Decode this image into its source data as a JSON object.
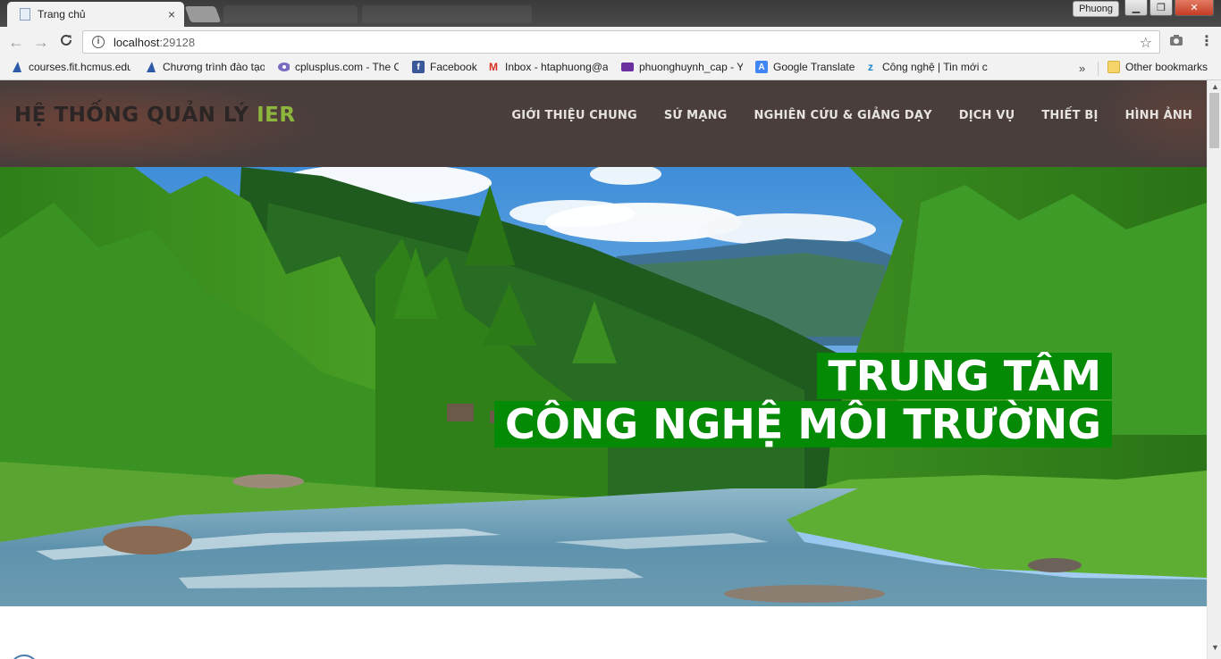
{
  "browser": {
    "tab_title": "Trang chủ",
    "tab_close": "×",
    "profile_name": "Phuong",
    "win_minimize": "▁",
    "win_maximize": "❐",
    "win_close": "✕",
    "url_host": "localhost",
    "url_port": ":29128",
    "back_icon": "←",
    "forward_icon": "→",
    "reload_icon": "C",
    "info_icon": "i",
    "star_icon": "☆",
    "camera_icon": "📷",
    "menu_icon": "⋮",
    "bookmarks": [
      {
        "label": "courses.fit.hcmus.edu",
        "icon": "wedge-icon",
        "color": "#2d5aa8"
      },
      {
        "label": "Chương trình đào tạo",
        "icon": "wedge-icon",
        "color": "#2d5aa8"
      },
      {
        "label": "cplusplus.com - The C",
        "icon": "puzzle-icon",
        "color": "#7a6ac0"
      },
      {
        "label": "Facebook",
        "icon": "facebook-icon",
        "color": "#3b5998"
      },
      {
        "label": "Inbox - htaphuong@a",
        "icon": "gmail-icon",
        "color": "#d93025"
      },
      {
        "label": "phuonghuynh_cap - Y",
        "icon": "mail-icon",
        "color": "#6b2fa0"
      },
      {
        "label": "Google Translate",
        "icon": "translate-icon",
        "color": "#4285f4"
      },
      {
        "label": "Công nghệ | Tin mới c",
        "icon": "zing-icon",
        "color": "#1e88c8"
      }
    ],
    "bookmarks_more": "»",
    "other_bookmarks": "Other bookmarks"
  },
  "site": {
    "brand_main": "HỆ THỐNG QUẢN LÝ ",
    "brand_accent": "IER",
    "nav": [
      "GIỚI THIỆU CHUNG",
      "SỨ MẠNG",
      "NGHIÊN CỨU & GIẢNG DẠY",
      "DỊCH VỤ",
      "THIẾT BỊ",
      "HÌNH ẢNH"
    ],
    "hero_line1": "TRUNG TÂM",
    "hero_line2": "CÔNG NGHỆ MÔI TRƯỜNG",
    "colors": {
      "header_bg": "#4a3e3d",
      "brand_text": "#2b2525",
      "brand_accent": "#8db63c",
      "hero_badge": "#058a05"
    }
  }
}
